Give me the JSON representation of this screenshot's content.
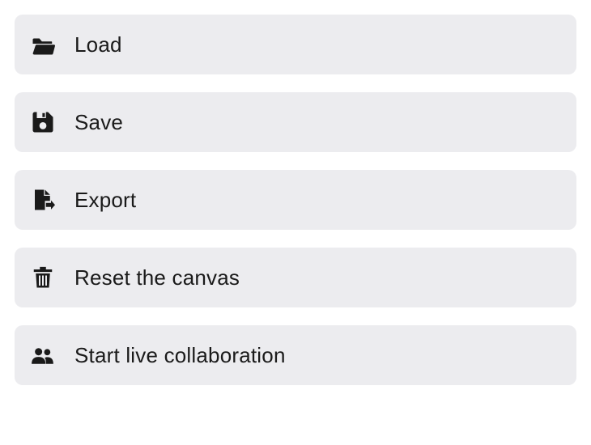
{
  "menu": {
    "load": {
      "label": "Load"
    },
    "save": {
      "label": "Save"
    },
    "export": {
      "label": "Export"
    },
    "reset": {
      "label": "Reset the canvas"
    },
    "collab": {
      "label": "Start live collaboration"
    }
  }
}
